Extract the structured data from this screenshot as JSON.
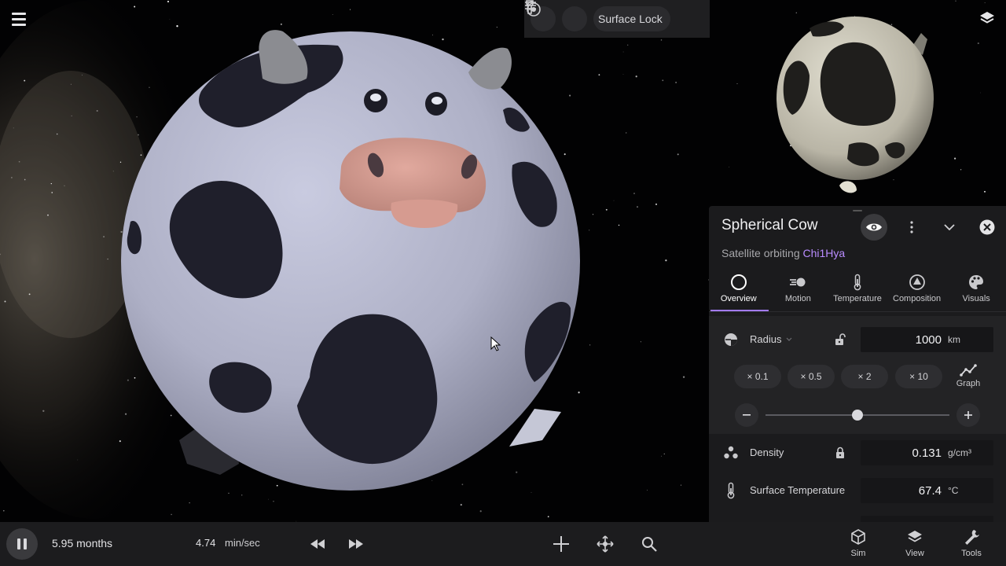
{
  "toolbar": {
    "surface_lock_label": "Surface Lock"
  },
  "panel": {
    "title": "Spherical Cow",
    "subtitle_prefix": "Satellite orbiting",
    "subtitle_link": "Chi1Hya",
    "tabs": [
      {
        "label": "Overview",
        "icon": "circle-icon",
        "active": true
      },
      {
        "label": "Motion",
        "icon": "motion-icon",
        "active": false
      },
      {
        "label": "Temperature",
        "icon": "thermometer-icon",
        "active": false
      },
      {
        "label": "Composition",
        "icon": "composition-icon",
        "active": false
      },
      {
        "label": "Visuals",
        "icon": "palette-icon",
        "active": false
      }
    ],
    "radius": {
      "label": "Radius",
      "value": "1000",
      "unit": "km",
      "slider_fraction": 0.5
    },
    "multipliers": [
      "× 0.1",
      "× 0.5",
      "× 2",
      "× 10"
    ],
    "graph_label": "Graph",
    "density": {
      "label": "Density",
      "value": "0.131",
      "unit": "g/cm³"
    },
    "surface_temperature": {
      "label": "Surface Temperature",
      "value": "67.4",
      "unit": "°C"
    }
  },
  "bottom": {
    "elapsed": "5.95 months",
    "rate_value": "4.74",
    "rate_unit": "min/sec",
    "nav": [
      {
        "label": "Sim",
        "icon": "cube-icon"
      },
      {
        "label": "View",
        "icon": "layers-icon"
      },
      {
        "label": "Tools",
        "icon": "wrench-icon"
      }
    ]
  },
  "colors": {
    "accent": "#a37bff",
    "link": "#b98cff",
    "panel_bg": "#1b1b1d",
    "bar_bg": "#1c1c1e"
  }
}
